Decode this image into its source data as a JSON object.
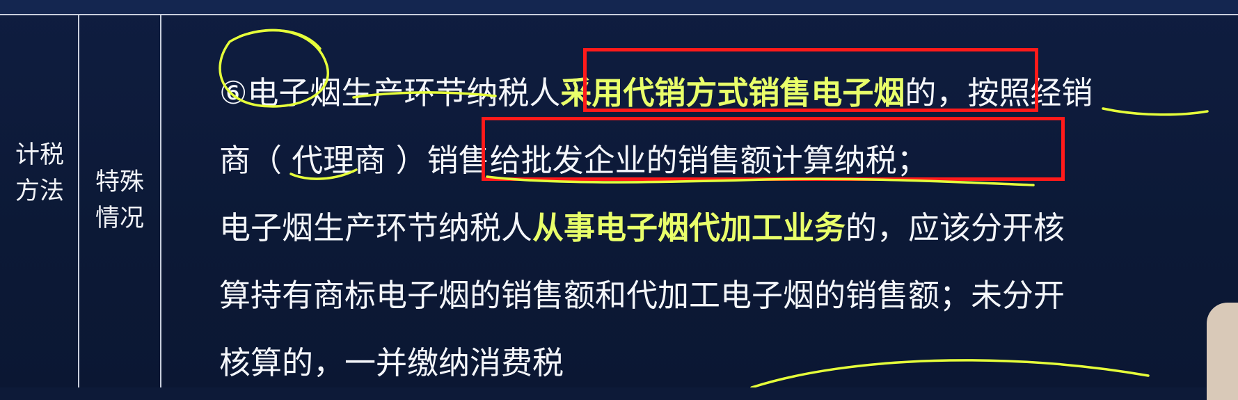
{
  "table": {
    "category": [
      "计税",
      "方法"
    ],
    "subcategory": [
      "特殊",
      "情况"
    ]
  },
  "content": {
    "line1": {
      "marker": "⑥",
      "part1": "电子烟生产环节纳税人",
      "highlight": "采用代销方式销售电子烟",
      "part2": "的，按照经销"
    },
    "line2": {
      "part1": "商（ 代理商 ）",
      "part2": "销售给批发企业的销售额计算纳税；"
    },
    "line3": {
      "part1": "电子烟生产环节纳税人",
      "highlight": "从事电子烟代加工业务",
      "part2": "的，应该分开核"
    },
    "line4": "算持有商标电子烟的销售额和代加工电子烟的销售额；未分开",
    "line5": "核算的，一并缴纳消费税"
  },
  "colors": {
    "background": "#0d1a38",
    "text": "#f4f6fa",
    "highlight": "#e9ff6a",
    "box": "#ff1a1a",
    "annotation": "#e6ff3a"
  }
}
